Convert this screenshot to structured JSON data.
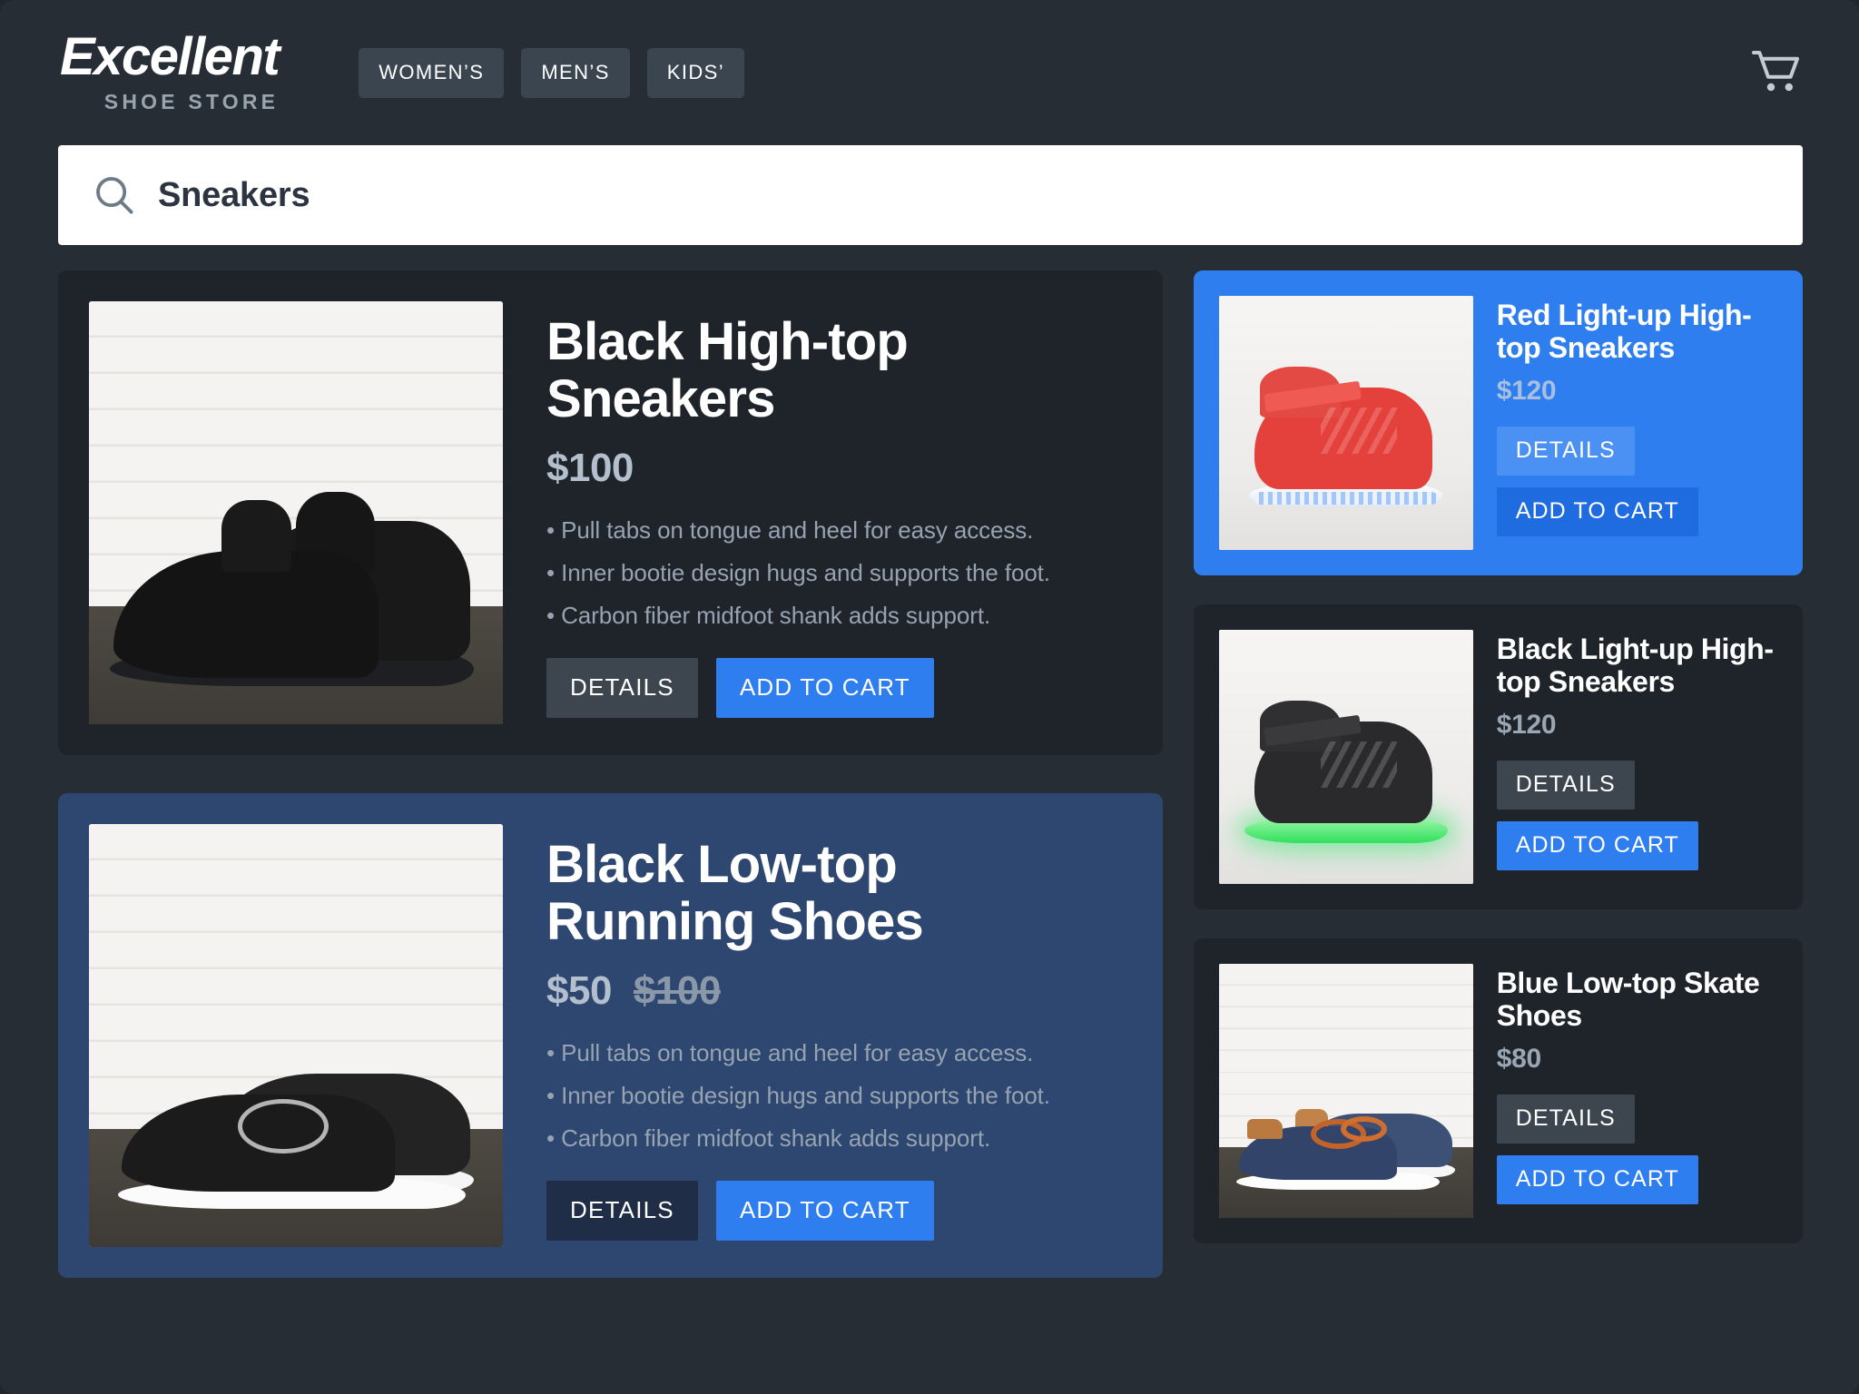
{
  "header": {
    "brand_name": "Excellent",
    "brand_sub": "SHOE STORE",
    "nav": [
      {
        "label": "WOMEN’S"
      },
      {
        "label": "MEN’S"
      },
      {
        "label": "KIDS’"
      }
    ],
    "cart_icon": "shopping-cart-icon"
  },
  "search": {
    "icon": "search-icon",
    "value": "Sneakers",
    "placeholder": "Sneakers"
  },
  "buttons": {
    "details": "DETAILS",
    "add_to_cart": "ADD TO CART"
  },
  "colors": {
    "page_bg": "#272d34",
    "card_bg": "#1f242b",
    "accent_blue": "#2f7ef0",
    "highlight_navy": "#2d4770",
    "price_text": "#b3bfcc",
    "body_text": "#97a3b1"
  },
  "featured": [
    {
      "title": "Black High-top Sneakers",
      "price": "$100",
      "price_old": "",
      "image_alt": "black-high-top-sneakers-photo",
      "features": [
        "• Pull tabs on tongue and heel for easy access.",
        "• Inner bootie design hugs and supports the foot.",
        "• Carbon fiber midfoot shank adds support."
      ]
    },
    {
      "title": "Black Low-top Running Shoes",
      "price": "$50",
      "price_old": "$100",
      "image_alt": "black-low-top-running-shoes-photo",
      "features": [
        "• Pull tabs on tongue and heel for easy access.",
        "• Inner bootie design hugs and supports the foot.",
        "• Carbon fiber midfoot shank adds support."
      ]
    }
  ],
  "sidebar": [
    {
      "title": "Red Light-up High-top Sneakers",
      "price": "$120",
      "image_alt": "red-light-up-high-top-sneakers-photo",
      "highlighted": true
    },
    {
      "title": "Black Light-up High-top Sneakers",
      "price": "$120",
      "image_alt": "black-light-up-high-top-sneakers-photo",
      "highlighted": false
    },
    {
      "title": "Blue Low-top Skate Shoes",
      "price": "$80",
      "image_alt": "blue-low-top-skate-shoes-photo",
      "highlighted": false
    }
  ]
}
